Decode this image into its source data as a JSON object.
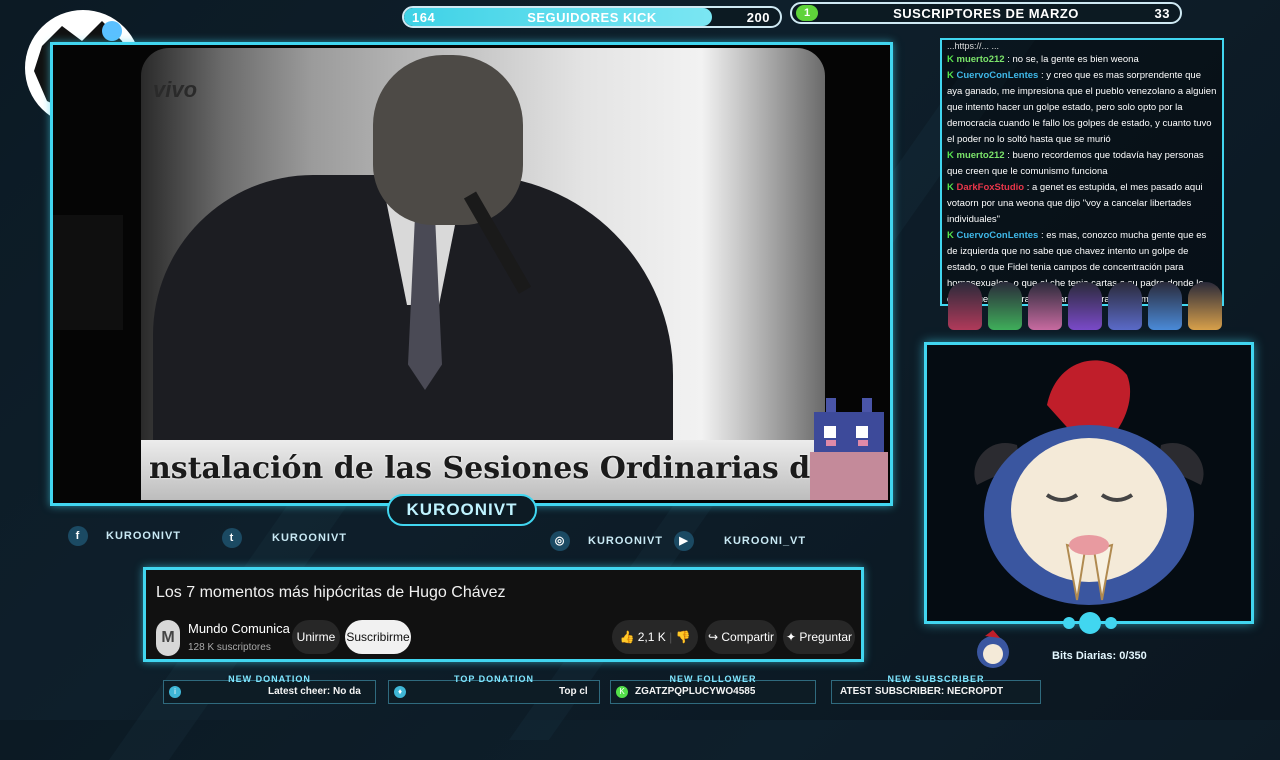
{
  "counters": {
    "followers": {
      "current": "164",
      "label": "SEGUIDORES KICK",
      "goal": "200",
      "progress": 0.82
    },
    "subscribers": {
      "badge": "1",
      "label": "SUSCRIPTORES DE MARZO",
      "goal": "33"
    }
  },
  "video": {
    "corner_text": "vivo",
    "caption": "nstalación de las Sesiones Ordinarias de la Asamblea Nac"
  },
  "nameplate": "KUROONIVT",
  "socials": [
    {
      "icon": "facebook-icon",
      "glyph": "f",
      "handle": "KUROONIVT"
    },
    {
      "icon": "twitter-icon",
      "glyph": "t",
      "handle": "KUROONIVT"
    },
    {
      "icon": "instagram-icon",
      "glyph": "◎",
      "handle": "KUROONIVT"
    },
    {
      "icon": "youtube-icon",
      "glyph": "▶",
      "handle": "KUROONI_VT"
    }
  ],
  "youtube": {
    "title": "Los 7 momentos más hipócritas de Hugo Chávez",
    "avatar_letter": "M",
    "channel": "Mundo Comunica",
    "verified": "✓",
    "subscribers": "128 K suscriptores",
    "join_label": "Unirme",
    "subscribe_label": "Suscribirme",
    "likes": "2,1 K",
    "share_label": "Compartir",
    "ask_label": "Preguntar"
  },
  "chat": {
    "top_fragment": "...https://... ...",
    "messages": [
      {
        "user": "muerto212",
        "color": "#7be36a",
        "text": ": no se, la gente es bien weona"
      },
      {
        "user": "CuervoConLentes",
        "color": "#3fb8e8",
        "text": ": y creo que es mas sorprendente que aya ganado, me impresiona que el pueblo venezolano a alguien que intento hacer un golpe estado, pero solo opto por la democracia cuando le fallo los golpes de estado, y cuanto tuvo el poder no lo soltó hasta que se murió"
      },
      {
        "user": "muerto212",
        "color": "#7be36a",
        "text": ": bueno recordemos que todavía hay personas que creen que le comunismo funciona"
      },
      {
        "user": "DarkFoxStudio",
        "color": "#e8364a",
        "text": ": a genet es estupida, el mes pasado aqui votaorn por una weona que dijo \"voy a cancelar libertades individuales\""
      },
      {
        "user": "CuervoConLentes",
        "color": "#3fb8e8",
        "text": ": es mas, conozco mucha gente que es de izquierda que no sabe que chavez intento un golpe de estado, o que Fidel tenia campos de concentración para homosexuales, o que el che tenia cartas a su padre donde le decia que le encaraba matar y que era lo que m... le l..."
      }
    ]
  },
  "bits": {
    "label": "Bits Diarias:",
    "value": "0/350"
  },
  "alerts": [
    {
      "caption": "NEW DONATION",
      "value": "Latest cheer: No da",
      "icon": "info-icon"
    },
    {
      "caption": "TOP DONATION",
      "value": "Top cl",
      "icon": "water-drop-icon"
    },
    {
      "caption": "NEW FOLLOWER",
      "value": "ZGATZPQPLUCYWO4585",
      "icon": "kick-icon"
    },
    {
      "caption": "NEW SUBSCRIBER",
      "value": "ATEST SUBSCRIBER: NECROPDT",
      "icon": "none"
    }
  ]
}
